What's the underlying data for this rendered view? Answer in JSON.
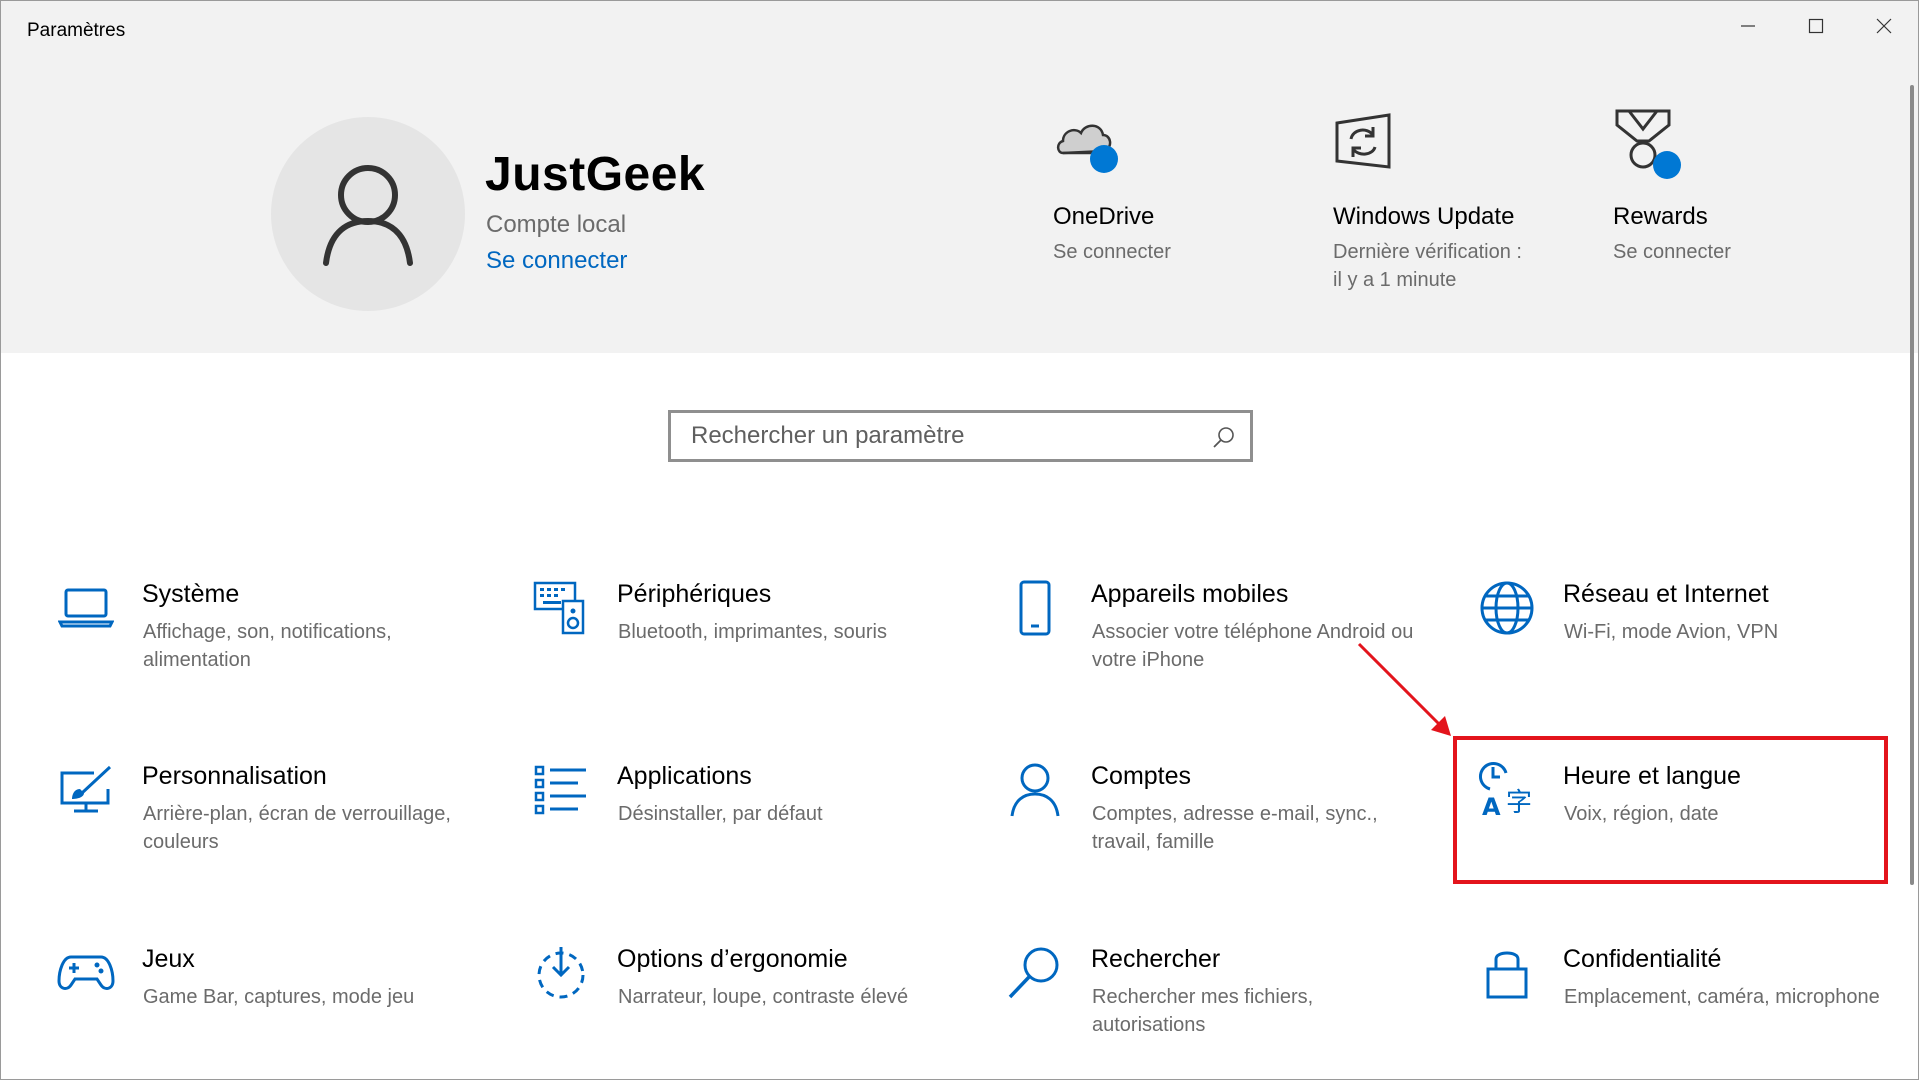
{
  "window": {
    "title": "Paramètres"
  },
  "account": {
    "name": "JustGeek",
    "type": "Compte local",
    "connect_label": "Se connecter"
  },
  "quick_links": [
    {
      "title": "OneDrive",
      "subtitle": "Se connecter",
      "icon": "onedrive-cloud-icon"
    },
    {
      "title": "Windows Update",
      "subtitle": "Dernière vérification : il y a 1 minute",
      "icon": "windows-update-icon"
    },
    {
      "title": "Rewards",
      "subtitle": "Se connecter",
      "icon": "rewards-medal-icon"
    }
  ],
  "search": {
    "placeholder": "Rechercher un paramètre",
    "value": ""
  },
  "categories": [
    {
      "title": "Système",
      "desc": "Affichage, son, notifications, alimentation",
      "icon": "laptop-icon"
    },
    {
      "title": "Périphériques",
      "desc": "Bluetooth, imprimantes, souris",
      "icon": "devices-icon"
    },
    {
      "title": "Appareils mobiles",
      "desc": "Associer votre téléphone Android ou votre iPhone",
      "icon": "phone-icon"
    },
    {
      "title": "Réseau et Internet",
      "desc": "Wi-Fi, mode Avion, VPN",
      "icon": "globe-icon"
    },
    {
      "title": "Personnalisation",
      "desc": "Arrière-plan, écran de verrouillage, couleurs",
      "icon": "personalization-icon"
    },
    {
      "title": "Applications",
      "desc": "Désinstaller, par défaut",
      "icon": "apps-list-icon"
    },
    {
      "title": "Comptes",
      "desc": "Comptes, adresse e-mail, sync., travail, famille",
      "icon": "person-icon"
    },
    {
      "title": "Heure et langue",
      "desc": "Voix, région, date",
      "icon": "time-language-icon"
    },
    {
      "title": "Jeux",
      "desc": "Game Bar, captures, mode jeu",
      "icon": "gamepad-icon"
    },
    {
      "title": "Options d’ergonomie",
      "desc": "Narrateur, loupe, contraste élevé",
      "icon": "ease-of-access-icon"
    },
    {
      "title": "Rechercher",
      "desc": "Rechercher mes fichiers, autorisations",
      "icon": "search-icon"
    },
    {
      "title": "Confidentialité",
      "desc": "Emplacement, caméra, microphone",
      "icon": "lock-icon"
    }
  ],
  "colors": {
    "accent": "#0067c0",
    "header_bg": "#f2f2f2",
    "annotation": "#e3141c",
    "secondary_text": "#6b6b6b"
  }
}
